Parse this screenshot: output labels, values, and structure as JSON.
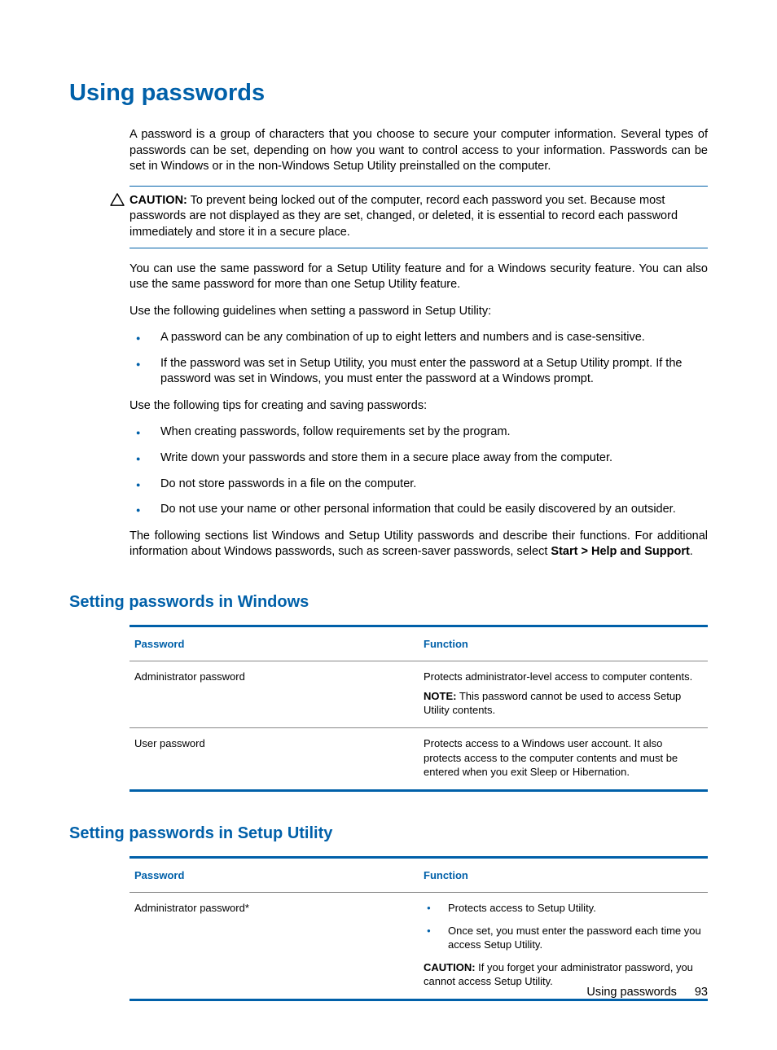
{
  "heading": "Using passwords",
  "intro_p1": "A password is a group of characters that you choose to secure your computer information. Several types of passwords can be set, depending on how you want to control access to your information. Passwords can be set in Windows or in the non-Windows Setup Utility preinstalled on the computer.",
  "caution_label": "CAUTION:",
  "caution_text": "To prevent being locked out of the computer, record each password you set. Because most passwords are not displayed as they are set, changed, or deleted, it is essential to record each password immediately and store it in a secure place.",
  "p2": "You can use the same password for a Setup Utility feature and for a Windows security feature. You can also use the same password for more than one Setup Utility feature.",
  "p3": "Use the following guidelines when setting a password in Setup Utility:",
  "list1": [
    "A password can be any combination of up to eight letters and numbers and is case-sensitive.",
    "If the password was set in Setup Utility, you must enter the password at a Setup Utility prompt. If the password was set in Windows, you must enter the password at a Windows prompt."
  ],
  "p4": "Use the following tips for creating and saving passwords:",
  "list2": [
    "When creating passwords, follow requirements set by the program.",
    "Write down your passwords and store them in a secure place away from the computer.",
    "Do not store passwords in a file on the computer.",
    "Do not use your name or other personal information that could be easily discovered by an outsider."
  ],
  "p5_a": "The following sections list Windows and Setup Utility passwords and describe their functions. For additional information about Windows passwords, such as screen-saver passwords, select ",
  "p5_b": "Start  >  Help and Support",
  "p5_c": ".",
  "sec1_h": "Setting passwords in Windows",
  "table1": {
    "col1": "Password",
    "col2": "Function",
    "rows": [
      {
        "c1": "Administrator password",
        "c2_main": "Protects administrator-level access to computer contents.",
        "note_label": "NOTE:",
        "note_text": "This password cannot be used to access Setup Utility contents."
      },
      {
        "c1": "User password",
        "c2_main": "Protects access to a Windows user account. It also protects access to the computer contents and must be entered when you exit Sleep or Hibernation."
      }
    ]
  },
  "sec2_h": "Setting passwords in Setup Utility",
  "table2": {
    "col1": "Password",
    "col2": "Function",
    "rows": [
      {
        "c1": "Administrator password*",
        "bullets": [
          "Protects access to Setup Utility.",
          "Once set, you must enter the password each time you access Setup Utility."
        ],
        "caution_label": "CAUTION:",
        "caution_text": "If you forget your administrator password, you cannot access Setup Utility."
      }
    ]
  },
  "footer_title": "Using passwords",
  "footer_page": "93"
}
